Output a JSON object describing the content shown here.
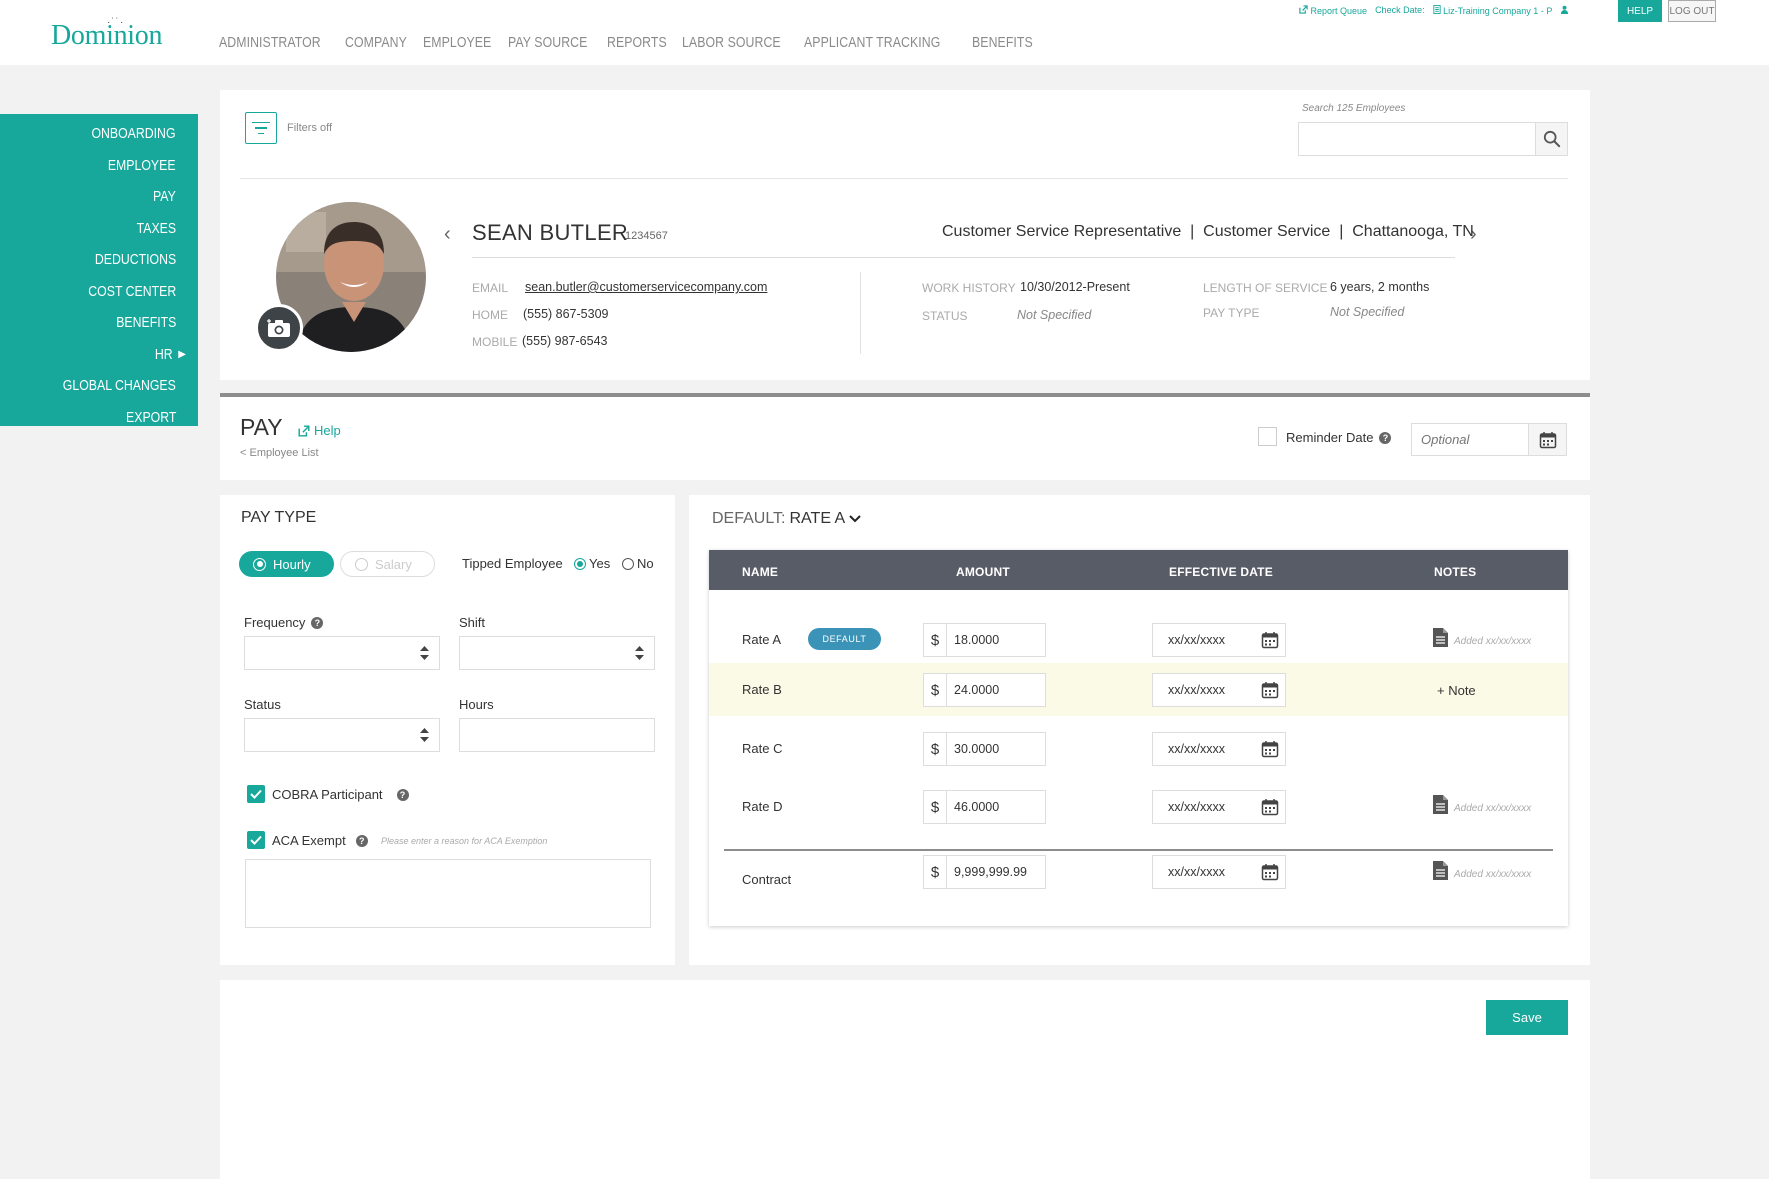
{
  "brand": {
    "logo_text": "Dominion",
    "logo_dots": "·˙˙·"
  },
  "top_nav": [
    "ADMINISTRATOR",
    "COMPANY",
    "EMPLOYEE",
    "PAY SOURCE",
    "REPORTS",
    "LABOR SOURCE",
    "APPLICANT TRACKING",
    "BENEFITS"
  ],
  "top_links": {
    "report_queue": "Report Queue",
    "check_date": "Check Date:",
    "company": "Liz-Training Company 1 - P",
    "help": "HELP",
    "logout": "LOG OUT"
  },
  "sidebar": [
    "ONBOARDING",
    "EMPLOYEE",
    "PAY",
    "TAXES",
    "DEDUCTIONS",
    "COST CENTER",
    "BENEFITS",
    "HR",
    "GLOBAL CHANGES",
    "EXPORT"
  ],
  "filters": {
    "label": "Filters off"
  },
  "search": {
    "label": "Search 125 Employees",
    "placeholder": ""
  },
  "employee": {
    "name": "SEAN BUTLER",
    "id": "1234567",
    "title_line": "Customer Service Representative  |  Customer Service  |  Chattanooga, TN",
    "email_label": "EMAIL",
    "email": "sean.butler@customerservicecompany.com",
    "home_label": "HOME",
    "home": "(555) 867-5309",
    "mobile_label": "MOBILE",
    "mobile": "(555) 987-6543",
    "work_history_label": "WORK HISTORY",
    "work_history": "10/30/2012-Present",
    "status_label": "STATUS",
    "status": "Not Specified",
    "length_label": "LENGTH OF SERVICE",
    "length": "6 years, 2 months",
    "pay_type_label": "PAY TYPE",
    "pay_type": "Not Specified"
  },
  "pay_header": {
    "title": "PAY",
    "help": "Help",
    "back": "< Employee List",
    "reminder_label": "Reminder Date",
    "reminder_placeholder": "Optional"
  },
  "pay_type": {
    "title": "PAY TYPE",
    "hourly": "Hourly",
    "salary": "Salary",
    "tipped_label": "Tipped Employee",
    "yes": "Yes",
    "no": "No",
    "frequency_label": "Frequency",
    "shift_label": "Shift",
    "status_label": "Status",
    "hours_label": "Hours",
    "cobra_label": "COBRA Participant",
    "aca_label": "ACA Exempt",
    "aca_note": "Please enter a reason for ACA Exemption"
  },
  "rates": {
    "default_prefix": "DEFAULT:",
    "default_value": "RATE A",
    "headers": [
      "NAME",
      "AMOUNT",
      "EFFECTIVE DATE",
      "NOTES"
    ],
    "badge": "DEFAULT",
    "currency": "$",
    "rows": [
      {
        "name": "Rate A",
        "amount": "18.0000",
        "date": "xx/xx/xxxx",
        "note": "Added xx/xx/xxxx"
      },
      {
        "name": "Rate B",
        "amount": "24.0000",
        "date": "xx/xx/xxxx",
        "note": "+ Note"
      },
      {
        "name": "Rate C",
        "amount": "30.0000",
        "date": "xx/xx/xxxx",
        "note": ""
      },
      {
        "name": "Rate D",
        "amount": "46.0000",
        "date": "xx/xx/xxxx",
        "note": "Added xx/xx/xxxx"
      },
      {
        "name": "Contract",
        "amount": "9,999,999.99",
        "date": "xx/xx/xxxx",
        "note": "Added xx/xx/xxxx"
      }
    ]
  },
  "actions": {
    "save": "Save"
  },
  "colors": {
    "accent": "#17a79b",
    "header_dark": "#575c66",
    "badge_blue": "#3b93b8",
    "highlight_row": "#fbfae6"
  }
}
